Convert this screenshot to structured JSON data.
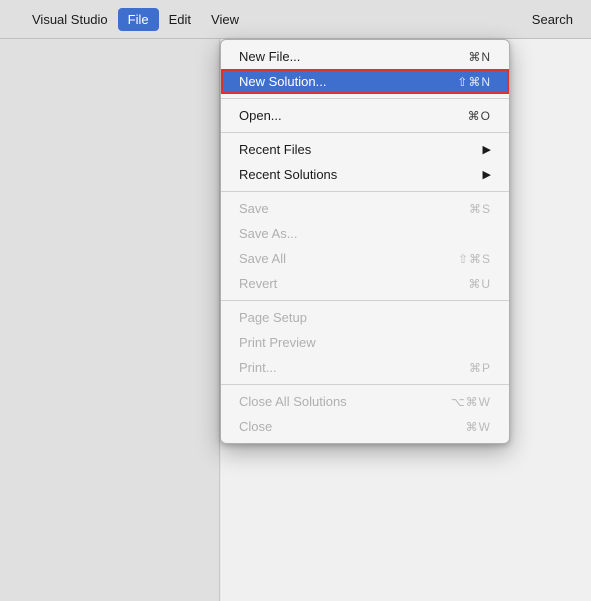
{
  "menubar": {
    "apple_icon": "",
    "app_name": "Visual Studio",
    "items": [
      {
        "label": "File",
        "active": true
      },
      {
        "label": "Edit",
        "active": false
      },
      {
        "label": "View",
        "active": false
      },
      {
        "label": "Search",
        "active": false
      }
    ]
  },
  "dropdown": {
    "items": [
      {
        "id": "new-file",
        "label": "New File...",
        "shortcut": "⌘N",
        "disabled": false,
        "highlighted": false,
        "hasArrow": false,
        "separator_after": false
      },
      {
        "id": "new-solution",
        "label": "New Solution...",
        "shortcut": "⇧⌘N",
        "disabled": false,
        "highlighted": true,
        "hasArrow": false,
        "separator_after": true
      },
      {
        "id": "open",
        "label": "Open...",
        "shortcut": "⌘O",
        "disabled": false,
        "highlighted": false,
        "hasArrow": false,
        "separator_after": true
      },
      {
        "id": "recent-files",
        "label": "Recent Files",
        "shortcut": "",
        "disabled": false,
        "highlighted": false,
        "hasArrow": true,
        "separator_after": false
      },
      {
        "id": "recent-solutions",
        "label": "Recent Solutions",
        "shortcut": "",
        "disabled": false,
        "highlighted": false,
        "hasArrow": true,
        "separator_after": true
      },
      {
        "id": "save",
        "label": "Save",
        "shortcut": "⌘S",
        "disabled": true,
        "highlighted": false,
        "hasArrow": false,
        "separator_after": false
      },
      {
        "id": "save-as",
        "label": "Save As...",
        "shortcut": "",
        "disabled": true,
        "highlighted": false,
        "hasArrow": false,
        "separator_after": false
      },
      {
        "id": "save-all",
        "label": "Save All",
        "shortcut": "⇧⌘S",
        "disabled": true,
        "highlighted": false,
        "hasArrow": false,
        "separator_after": false
      },
      {
        "id": "revert",
        "label": "Revert",
        "shortcut": "⌘U",
        "disabled": true,
        "highlighted": false,
        "hasArrow": false,
        "separator_after": true
      },
      {
        "id": "page-setup",
        "label": "Page Setup",
        "shortcut": "",
        "disabled": true,
        "highlighted": false,
        "hasArrow": false,
        "separator_after": false
      },
      {
        "id": "print-preview",
        "label": "Print Preview",
        "shortcut": "",
        "disabled": true,
        "highlighted": false,
        "hasArrow": false,
        "separator_after": false
      },
      {
        "id": "print",
        "label": "Print...",
        "shortcut": "⌘P",
        "disabled": true,
        "highlighted": false,
        "hasArrow": false,
        "separator_after": true
      },
      {
        "id": "close-all-solutions",
        "label": "Close All Solutions",
        "shortcut": "⌥⌘W",
        "disabled": true,
        "highlighted": false,
        "hasArrow": false,
        "separator_after": false
      },
      {
        "id": "close",
        "label": "Close",
        "shortcut": "⌘W",
        "disabled": true,
        "highlighted": false,
        "hasArrow": false,
        "separator_after": false
      }
    ]
  }
}
